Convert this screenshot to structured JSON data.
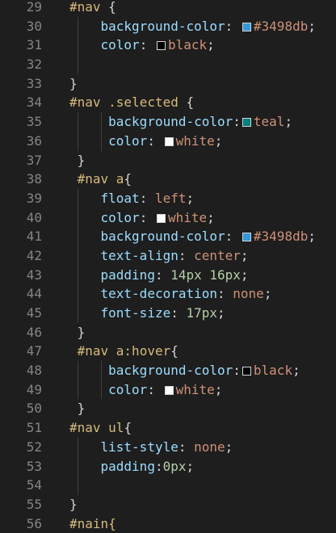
{
  "lines": [
    {
      "n": "29",
      "indent": 0,
      "guides": [],
      "tokens": [
        {
          "t": "#nav",
          "c": "sel"
        },
        {
          "t": " {",
          "c": "punc"
        }
      ]
    },
    {
      "n": "30",
      "indent": 4,
      "guides": [
        1
      ],
      "tokens": [
        {
          "t": "background-color",
          "c": "prop"
        },
        {
          "t": ": ",
          "c": "punc"
        },
        {
          "sw": "#3498db"
        },
        {
          "t": "#3498db",
          "c": "val"
        },
        {
          "t": ";",
          "c": "punc"
        }
      ]
    },
    {
      "n": "31",
      "indent": 4,
      "guides": [
        1
      ],
      "tokens": [
        {
          "t": "color",
          "c": "prop"
        },
        {
          "t": ": ",
          "c": "punc"
        },
        {
          "sw": "#000000"
        },
        {
          "t": "black",
          "c": "val"
        },
        {
          "t": ";",
          "c": "punc"
        }
      ]
    },
    {
      "n": "32",
      "indent": 0,
      "guides": [
        1
      ],
      "tokens": []
    },
    {
      "n": "33",
      "indent": 0,
      "guides": [],
      "tokens": [
        {
          "t": "}",
          "c": "punc"
        }
      ]
    },
    {
      "n": "34",
      "indent": 0,
      "guides": [],
      "tokens": [
        {
          "t": "#nav .selected",
          "c": "sel"
        },
        {
          "t": " {",
          "c": "punc"
        }
      ]
    },
    {
      "n": "35",
      "indent": 5,
      "guides": [
        1,
        4
      ],
      "tokens": [
        {
          "t": "background-color",
          "c": "prop"
        },
        {
          "t": ":",
          "c": "punc"
        },
        {
          "sw": "#008080"
        },
        {
          "t": "teal",
          "c": "val"
        },
        {
          "t": ";",
          "c": "punc"
        }
      ]
    },
    {
      "n": "36",
      "indent": 5,
      "guides": [
        1,
        4
      ],
      "tokens": [
        {
          "t": "color",
          "c": "prop"
        },
        {
          "t": ": ",
          "c": "punc"
        },
        {
          "sw": "#ffffff"
        },
        {
          "t": "white",
          "c": "val"
        },
        {
          "t": ";",
          "c": "punc"
        }
      ]
    },
    {
      "n": "37",
      "indent": 1,
      "guides": [],
      "tokens": [
        {
          "t": "}",
          "c": "punc"
        }
      ]
    },
    {
      "n": "38",
      "indent": 1,
      "guides": [],
      "tokens": [
        {
          "t": "#nav a",
          "c": "sel"
        },
        {
          "t": "{",
          "c": "punc"
        }
      ]
    },
    {
      "n": "39",
      "indent": 4,
      "guides": [
        1
      ],
      "tokens": [
        {
          "t": "float",
          "c": "prop"
        },
        {
          "t": ": ",
          "c": "punc"
        },
        {
          "t": "left",
          "c": "val"
        },
        {
          "t": ";",
          "c": "punc"
        }
      ]
    },
    {
      "n": "40",
      "indent": 4,
      "guides": [
        1
      ],
      "tokens": [
        {
          "t": "color",
          "c": "prop"
        },
        {
          "t": ": ",
          "c": "punc"
        },
        {
          "sw": "#ffffff"
        },
        {
          "t": "white",
          "c": "val"
        },
        {
          "t": ";",
          "c": "punc"
        }
      ]
    },
    {
      "n": "41",
      "indent": 4,
      "guides": [
        1
      ],
      "tokens": [
        {
          "t": "background-color",
          "c": "prop"
        },
        {
          "t": ": ",
          "c": "punc"
        },
        {
          "sw": "#3498db"
        },
        {
          "t": "#3498db",
          "c": "val"
        },
        {
          "t": ";",
          "c": "punc"
        }
      ]
    },
    {
      "n": "42",
      "indent": 4,
      "guides": [
        1
      ],
      "tokens": [
        {
          "t": "text-align",
          "c": "prop"
        },
        {
          "t": ": ",
          "c": "punc"
        },
        {
          "t": "center",
          "c": "val"
        },
        {
          "t": ";",
          "c": "punc"
        }
      ]
    },
    {
      "n": "43",
      "indent": 4,
      "guides": [
        1
      ],
      "tokens": [
        {
          "t": "padding",
          "c": "prop"
        },
        {
          "t": ": ",
          "c": "punc"
        },
        {
          "t": "14px 16px",
          "c": "num"
        },
        {
          "t": ";",
          "c": "punc"
        }
      ]
    },
    {
      "n": "44",
      "indent": 4,
      "guides": [
        1
      ],
      "tokens": [
        {
          "t": "text-decoration",
          "c": "prop"
        },
        {
          "t": ": ",
          "c": "punc"
        },
        {
          "t": "none",
          "c": "val"
        },
        {
          "t": ";",
          "c": "punc"
        }
      ]
    },
    {
      "n": "45",
      "indent": 4,
      "guides": [
        1
      ],
      "tokens": [
        {
          "t": "font-size",
          "c": "prop"
        },
        {
          "t": ": ",
          "c": "punc"
        },
        {
          "t": "17px",
          "c": "num"
        },
        {
          "t": ";",
          "c": "punc"
        }
      ]
    },
    {
      "n": "46",
      "indent": 1,
      "guides": [],
      "tokens": [
        {
          "t": "}",
          "c": "punc"
        }
      ]
    },
    {
      "n": "47",
      "indent": 1,
      "guides": [],
      "tokens": [
        {
          "t": "#nav a:hover",
          "c": "sel"
        },
        {
          "t": "{",
          "c": "punc"
        }
      ]
    },
    {
      "n": "48",
      "indent": 5,
      "guides": [
        1,
        4
      ],
      "tokens": [
        {
          "t": "background-color",
          "c": "prop"
        },
        {
          "t": ":",
          "c": "punc"
        },
        {
          "sw": "#000000"
        },
        {
          "t": "black",
          "c": "val"
        },
        {
          "t": ";",
          "c": "punc"
        }
      ]
    },
    {
      "n": "49",
      "indent": 5,
      "guides": [
        1,
        4
      ],
      "tokens": [
        {
          "t": "color",
          "c": "prop"
        },
        {
          "t": ": ",
          "c": "punc"
        },
        {
          "sw": "#ffffff"
        },
        {
          "t": "white",
          "c": "val"
        },
        {
          "t": ";",
          "c": "punc"
        }
      ]
    },
    {
      "n": "50",
      "indent": 1,
      "guides": [],
      "tokens": [
        {
          "t": "}",
          "c": "punc"
        }
      ]
    },
    {
      "n": "51",
      "indent": 0,
      "guides": [],
      "tokens": [
        {
          "t": "#nav ul",
          "c": "sel"
        },
        {
          "t": "{",
          "c": "punc"
        }
      ]
    },
    {
      "n": "52",
      "indent": 4,
      "guides": [
        1
      ],
      "tokens": [
        {
          "t": "list-style",
          "c": "prop"
        },
        {
          "t": ": ",
          "c": "punc"
        },
        {
          "t": "none",
          "c": "val"
        },
        {
          "t": ";",
          "c": "punc"
        }
      ]
    },
    {
      "n": "53",
      "indent": 4,
      "guides": [
        1
      ],
      "tokens": [
        {
          "t": "padding",
          "c": "prop"
        },
        {
          "t": ":",
          "c": "punc"
        },
        {
          "t": "0px",
          "c": "num"
        },
        {
          "t": ";",
          "c": "punc"
        }
      ]
    },
    {
      "n": "54",
      "indent": 0,
      "guides": [
        1
      ],
      "tokens": []
    },
    {
      "n": "55",
      "indent": 0,
      "guides": [],
      "tokens": [
        {
          "t": "}",
          "c": "punc"
        }
      ]
    },
    {
      "n": "56",
      "indent": 0,
      "guides": [],
      "tokens": [
        {
          "t": "#nain{",
          "c": "sel"
        }
      ]
    }
  ]
}
